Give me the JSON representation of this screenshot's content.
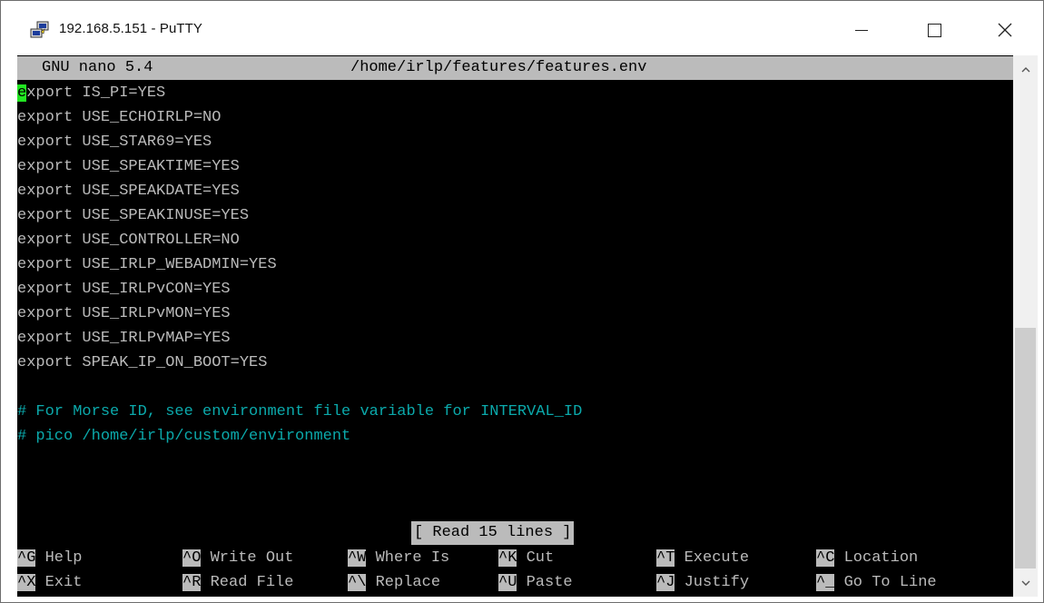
{
  "window": {
    "title": "192.168.5.151 - PuTTY",
    "icons": {
      "app": "putty-icon",
      "minimize": "minimize-icon",
      "maximize": "maximize-icon",
      "close": "close-icon"
    }
  },
  "nano": {
    "version": "GNU nano 5.4",
    "file_path": "/home/irlp/features/features.env"
  },
  "file_lines": [
    "export IS_PI=YES",
    "export USE_ECHOIRLP=NO",
    "export USE_STAR69=YES",
    "export USE_SPEAKTIME=YES",
    "export USE_SPEAKDATE=YES",
    "export USE_SPEAKINUSE=YES",
    "export USE_CONTROLLER=NO",
    "export USE_IRLP_WEBADMIN=YES",
    "export USE_IRLPvCON=YES",
    "export USE_IRLPvMON=YES",
    "export USE_IRLPvMAP=YES",
    "export SPEAK_IP_ON_BOOT=YES",
    "",
    "# For Morse ID, see environment file variable for INTERVAL_ID",
    "# pico /home/irlp/custom/environment"
  ],
  "status_message": "[ Read 15 lines ]",
  "shortcuts_row1": [
    {
      "key": "^G",
      "label": "Help"
    },
    {
      "key": "^O",
      "label": "Write Out"
    },
    {
      "key": "^W",
      "label": "Where Is"
    },
    {
      "key": "^K",
      "label": "Cut"
    },
    {
      "key": "^T",
      "label": "Execute"
    },
    {
      "key": "^C",
      "label": "Location"
    }
  ],
  "shortcuts_row2": [
    {
      "key": "^X",
      "label": "Exit"
    },
    {
      "key": "^R",
      "label": "Read File"
    },
    {
      "key": "^\\",
      "label": "Replace"
    },
    {
      "key": "^U",
      "label": "Paste"
    },
    {
      "key": "^J",
      "label": "Justify"
    },
    {
      "key": "^_",
      "label": "Go To Line"
    }
  ],
  "colors": {
    "terminal_bg": "#000000",
    "terminal_fg": "#bbbbbb",
    "comment": "#0ba9ab",
    "cursor": "#22e622",
    "header_bg": "#bbbbbb"
  }
}
